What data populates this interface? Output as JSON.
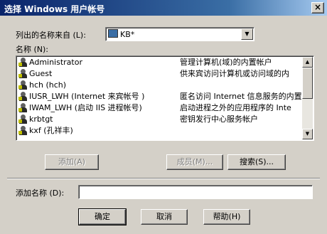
{
  "window": {
    "title": "选择 Windows 用户帐号",
    "close": "×"
  },
  "source": {
    "label": "列出的名称来自 (L):",
    "value": "KB*",
    "icon": "computer-icon"
  },
  "names_label": "名称 (N):",
  "users": [
    {
      "name": "Administrator",
      "desc": "管理计算机(域)的内置帐户"
    },
    {
      "name": "Guest",
      "desc": "供来宾访问计算机或访问域的内"
    },
    {
      "name": "hch (hch)",
      "desc": ""
    },
    {
      "name": "IUSR_LWH (Internet 来宾帐号 )",
      "desc": "匿名访问 Internet 信息服务的内置"
    },
    {
      "name": "IWAM_LWH (启动 IIS 进程帐号)",
      "desc": "启动进程之外的应用程序的 Inte"
    },
    {
      "name": "krbtgt",
      "desc": "密钥发行中心服务帐户"
    },
    {
      "name": "kxf (孔祥丰)",
      "desc": ""
    }
  ],
  "buttons": {
    "add": "添加(A)",
    "members": "成员(M)...",
    "search": "搜索(S)...",
    "ok": "确定",
    "cancel": "取消",
    "help": "帮助(H)"
  },
  "add_name_label": "添加名称 (D):",
  "add_name_value": ""
}
